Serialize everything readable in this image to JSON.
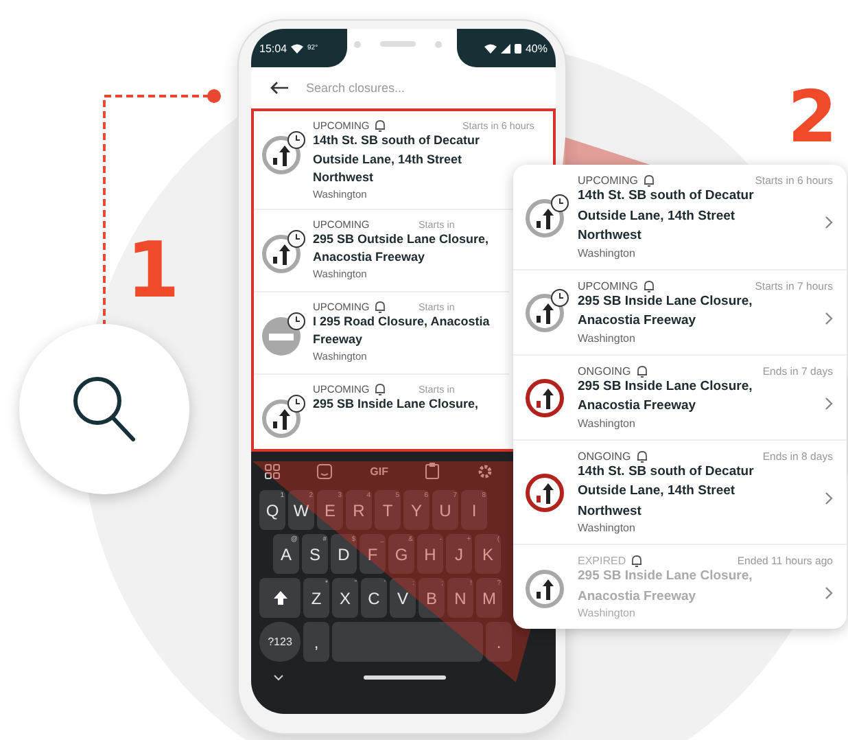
{
  "callouts": [
    {
      "number": "1"
    },
    {
      "number": "2"
    }
  ],
  "phone": {
    "status_bar": {
      "time": "15:04",
      "temperature": "92°",
      "battery": "40%"
    },
    "search": {
      "placeholder": "Search closures..."
    },
    "results": [
      {
        "kind": "upcoming",
        "status": "UPCOMING",
        "alert": true,
        "time": "Starts in 6 hours",
        "title": "14th St. SB south of Decatur Outside Lane, 14th Street Northwest",
        "place": "Washington"
      },
      {
        "kind": "upcoming",
        "status": "UPCOMING",
        "alert": false,
        "time": "Starts in",
        "title": "295 SB Outside Lane Closure, Anacostia Freeway",
        "place": "Washington"
      },
      {
        "kind": "upcoming_road",
        "status": "UPCOMING",
        "alert": true,
        "time": "Starts in",
        "title": "I 295 Road Closure, Anacostia Freeway",
        "place": "Washington"
      },
      {
        "kind": "upcoming",
        "status": "UPCOMING",
        "alert": true,
        "time": "Starts in",
        "title": "295 SB Inside Lane Closure,"
      }
    ],
    "keyboard": {
      "gif_label": "GIF",
      "rows": [
        [
          {
            "label": "Q",
            "hint": "1"
          },
          {
            "label": "W",
            "hint": "2"
          },
          {
            "label": "E",
            "hint": "3"
          },
          {
            "label": "R",
            "hint": "4"
          },
          {
            "label": "T",
            "hint": "5"
          },
          {
            "label": "Y",
            "hint": "6"
          },
          {
            "label": "U",
            "hint": "7"
          },
          {
            "label": "I",
            "hint": "8"
          }
        ],
        [
          {
            "label": "A",
            "hint": "@"
          },
          {
            "label": "S",
            "hint": "#"
          },
          {
            "label": "D",
            "hint": "$"
          },
          {
            "label": "F",
            "hint": "_"
          },
          {
            "label": "G",
            "hint": "&"
          },
          {
            "label": "H",
            "hint": "-"
          },
          {
            "label": "J",
            "hint": "+"
          },
          {
            "label": "K",
            "hint": "("
          }
        ],
        [
          {
            "label": "Z",
            "hint": "*"
          },
          {
            "label": "X",
            "hint": "\""
          },
          {
            "label": "C",
            "hint": "'"
          },
          {
            "label": "V",
            "hint": ":"
          },
          {
            "label": "B",
            "hint": ";"
          },
          {
            "label": "N",
            "hint": "!"
          },
          {
            "label": "M",
            "hint": "?"
          }
        ]
      ],
      "symbols_key": "?123",
      "comma_key": ",",
      "period_key": "."
    }
  },
  "detail_card": {
    "results": [
      {
        "kind": "upcoming",
        "status": "UPCOMING",
        "alert": true,
        "time": "Starts in 6 hours",
        "title": "14th St. SB south of Decatur Outside Lane, 14th Street Northwest",
        "place": "Washington"
      },
      {
        "kind": "upcoming",
        "status": "UPCOMING",
        "alert": true,
        "time": "Starts in 7 hours",
        "title": "295 SB Inside Lane Closure, Anacostia Freeway",
        "place": "Washington"
      },
      {
        "kind": "ongoing",
        "status": "ONGOING",
        "alert": true,
        "time": "Ends in 7 days",
        "title": "295 SB Inside Lane Closure, Anacostia Freeway",
        "place": "Washington"
      },
      {
        "kind": "ongoing",
        "status": "ONGOING",
        "alert": true,
        "time": "Ends in 8 days",
        "title": "14th St. SB south of Decatur Outside Lane, 14th Street Northwest",
        "place": "Washington"
      },
      {
        "kind": "expired",
        "status": "EXPIRED",
        "alert": true,
        "time": "Ended 11 hours ago",
        "title": "295 SB Inside Lane Closure, Anacostia Freeway",
        "place": "Washington"
      }
    ]
  }
}
